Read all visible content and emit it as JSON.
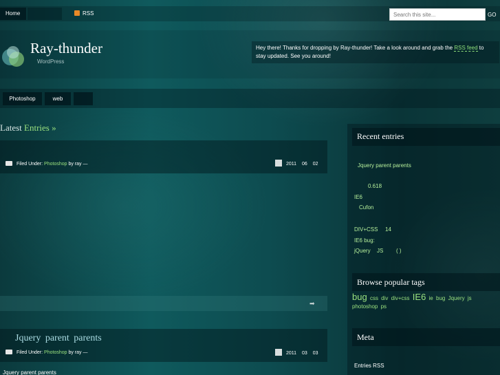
{
  "topnav": {
    "home": "Home",
    "rss": "RSS"
  },
  "search": {
    "placeholder": "Search this site...",
    "button": "GO"
  },
  "header": {
    "title": "Ray-thunder",
    "tagline": "WordPress",
    "welcome_before": "Hey there! Thanks for dropping by Ray-thunder! Take a look around and grab the ",
    "welcome_link": "RSS feed",
    "welcome_after": " to stay updated. See you around!"
  },
  "categories": {
    "photoshop": "Photoshop",
    "web": "web"
  },
  "content": {
    "latest_prefix": "Latest",
    "latest_link": "Entries »",
    "post1": {
      "filed_under": "Filed Under:",
      "category": "Photoshop",
      "by": "by ray —",
      "date": {
        "year": "2011",
        "month": "06",
        "day": "02"
      }
    },
    "post2": {
      "title": "Jquery parent parents",
      "filed_under": "Filed Under:",
      "category": "Photoshop",
      "by": "by ray —",
      "date": {
        "year": "2011",
        "month": "03",
        "day": "03"
      },
      "excerpt": "Jquery parent parents"
    },
    "more_arrow": "➡"
  },
  "sidebar": {
    "recent": {
      "heading": "Recent entries",
      "items": [
        "Jquery parent parents",
        "0.618",
        "IE6",
        "Cufon",
        "DIV+CSS",
        "14",
        "IE6 bug:",
        "jQuery",
        "JS",
        "( )"
      ]
    },
    "tags": {
      "heading": "Browse popular tags",
      "items": [
        "bug",
        "css",
        "div",
        "div+css",
        "IE6",
        "ie",
        "bug",
        "Jquery",
        "js",
        "photoshop",
        "ps"
      ]
    },
    "meta": {
      "heading": "Meta",
      "items": [
        "Entries RSS"
      ]
    }
  },
  "colors": {
    "accent_green": "#9be27f",
    "link_blue": "#a9dbe2",
    "rss_orange": "#e88a28"
  }
}
